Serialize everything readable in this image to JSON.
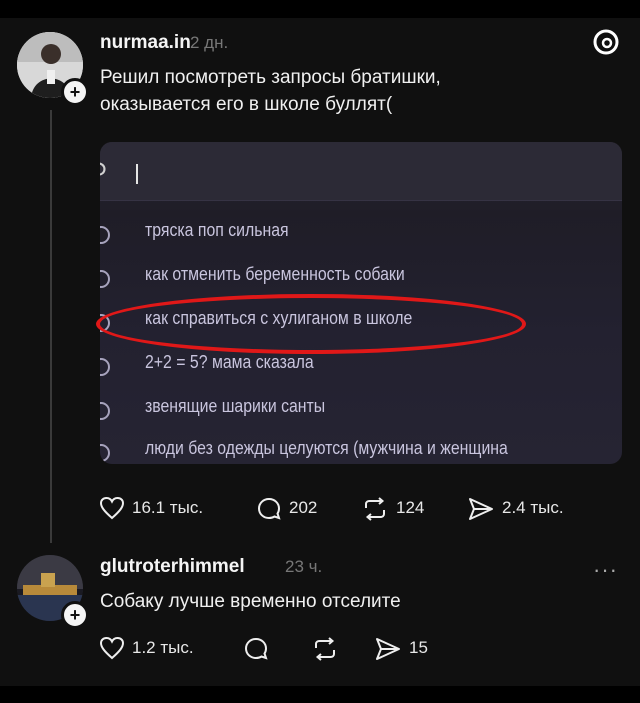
{
  "post": {
    "username": "nurmaa.in",
    "time": "2 дн.",
    "text_line1": "Решил посмотреть запросы братишки,",
    "text_line2": "оказывается его в школе буллят(",
    "screenshot": {
      "suggestions": [
        "тряска поп сильная",
        "как отменить беременность собаки",
        "как справиться с хулиганом в школе",
        "2+2 = 5? мама сказала",
        "звенящие шарики санты",
        "люди без одежды целуются (мужчина и женщина"
      ],
      "highlighted_index": 2
    },
    "actions": {
      "likes": "16.1 тыс.",
      "comments": "202",
      "reposts": "124",
      "shares": "2.4 тыс."
    }
  },
  "reply": {
    "username": "glutroterhimmel",
    "time": "23 ч.",
    "text": "Собаку лучше временно отселите",
    "actions": {
      "likes": "1.2 тыс.",
      "comments": "",
      "reposts": "",
      "shares": "15"
    }
  },
  "icons": {
    "threads_logo": "threads-logo-icon",
    "more": "more-options-icon",
    "heart": "heart-icon",
    "comment": "comment-icon",
    "repost": "repost-icon",
    "share": "share-icon"
  },
  "colors": {
    "highlight_oval": "#e01818",
    "background": "#101010"
  }
}
